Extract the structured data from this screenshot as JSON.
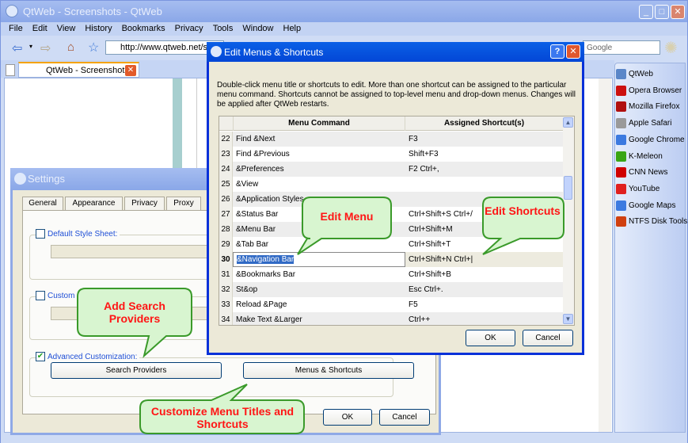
{
  "browser": {
    "title": "QtWeb - Screenshots - QtWeb",
    "menu": [
      "File",
      "Edit",
      "View",
      "History",
      "Bookmarks",
      "Privacy",
      "Tools",
      "Window",
      "Help"
    ],
    "url": "http://www.qtweb.net/scre",
    "search_placeholder": "Google",
    "tab_label": "QtWeb - Screenshots"
  },
  "sidebar": {
    "items": [
      {
        "label": "QtWeb",
        "icon": "qtweb-icon",
        "color": "#5a86c8"
      },
      {
        "label": "Opera Browser",
        "icon": "opera-icon",
        "color": "#cc1010"
      },
      {
        "label": "Mozilla Firefox",
        "icon": "firefox-icon",
        "color": "#b01010"
      },
      {
        "label": "Apple Safari",
        "icon": "apple-icon",
        "color": "#9a9a9a"
      },
      {
        "label": "Google Chrome",
        "icon": "google-icon",
        "color": "#3c7ae0"
      },
      {
        "label": "K-Meleon",
        "icon": "kmeleon-icon",
        "color": "#39a515"
      },
      {
        "label": "CNN News",
        "icon": "cnn-icon",
        "color": "#d00000"
      },
      {
        "label": "YouTube",
        "icon": "youtube-icon",
        "color": "#e02020"
      },
      {
        "label": "Google Maps",
        "icon": "google-icon",
        "color": "#3c7ae0"
      },
      {
        "label": "NTFS Disk Tools",
        "icon": "pill-icon",
        "color": "#d04010"
      }
    ]
  },
  "settings": {
    "title": "Settings",
    "tabs": [
      "General",
      "Appearance",
      "Privacy",
      "Proxy"
    ],
    "default_style_sheet": "Default Style Sheet:",
    "custom_user": "Custom Us",
    "advanced": "Advanced Customization:",
    "search_providers": "Search Providers",
    "menus_shortcuts": "Menus & Shortcuts",
    "ok": "OK",
    "cancel": "Cancel"
  },
  "edit_dialog": {
    "title": "Edit Menus & Shortcuts",
    "help": "?",
    "description": "Double-click menu title or shortcuts to edit. More than one shortcut can be assigned to the particular menu command. Shortcuts cannot be assigned to top-level menu and drop-down menus. Changes will be applied after QtWeb restarts.",
    "columns": [
      "Menu Command",
      "Assigned Shortcut(s)"
    ],
    "rows": [
      {
        "n": "22",
        "cmd": "Find &Next",
        "sc": "F3"
      },
      {
        "n": "23",
        "cmd": "Find &Previous",
        "sc": "Shift+F3"
      },
      {
        "n": "24",
        "cmd": "&Preferences",
        "sc": "F2 Ctrl+,"
      },
      {
        "n": "25",
        "cmd": "&View",
        "sc": ""
      },
      {
        "n": "26",
        "cmd": "&Application Styles",
        "sc": ""
      },
      {
        "n": "27",
        "cmd": "&Status Bar",
        "sc": "Ctrl+Shift+S Ctrl+/"
      },
      {
        "n": "28",
        "cmd": "&Menu Bar",
        "sc": "Ctrl+Shift+M"
      },
      {
        "n": "29",
        "cmd": "&Tab Bar",
        "sc": "Ctrl+Shift+T"
      },
      {
        "n": "30",
        "cmd": "&Navigation Bar",
        "sc": "Ctrl+Shift+N Ctrl+|",
        "selected": true
      },
      {
        "n": "31",
        "cmd": "&Bookmarks Bar",
        "sc": "Ctrl+Shift+B"
      },
      {
        "n": "32",
        "cmd": "St&op",
        "sc": "Esc Ctrl+."
      },
      {
        "n": "33",
        "cmd": "Reload &Page",
        "sc": "F5"
      },
      {
        "n": "34",
        "cmd": "Make Text &Larger",
        "sc": "Ctrl++"
      }
    ],
    "ok": "OK",
    "cancel": "Cancel"
  },
  "callouts": {
    "edit_menu": "Edit Menu",
    "edit_shortcuts": "Edit Shortcuts",
    "add_search": "Add Search Providers",
    "customize": "Customize Menu Titles and Shortcuts"
  },
  "colors": {
    "callout_text": "#ff1515",
    "callout_fill": "#d8f5d0",
    "callout_border": "#3a9a2a",
    "active_title": "#0a5fe6"
  }
}
